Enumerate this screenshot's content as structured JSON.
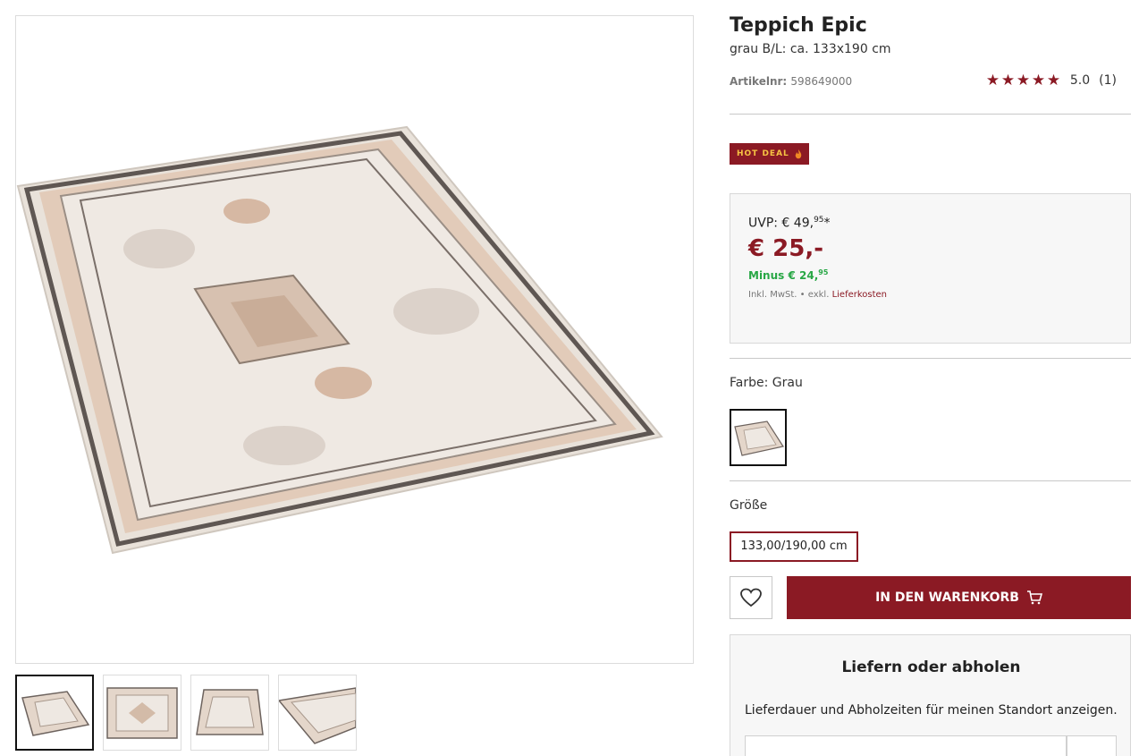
{
  "product": {
    "title": "Teppich Epic",
    "subtitle": "grau B/L: ca. 133x190 cm",
    "artnr_label": "Artikelnr:",
    "artnr_value": "598649000",
    "rating_value": "5.0",
    "rating_count": "(1)",
    "stars": 5
  },
  "badge": {
    "label": "HOT DEAL"
  },
  "pricing": {
    "uvp_prefix": "UVP: € 49,",
    "uvp_cents": "95",
    "uvp_suffix": "*",
    "price": "€ 25,-",
    "minus_prefix": "Minus € 24,",
    "minus_cents": "95",
    "tax_text": "Inkl. MwSt. • exkl.",
    "tax_link": "Lieferkosten"
  },
  "color": {
    "label": "Farbe: Grau"
  },
  "size": {
    "label": "Größe",
    "selected": "133,00/190,00 cm"
  },
  "actions": {
    "cart_label": "IN DEN WARENKORB"
  },
  "delivery": {
    "title": "Liefern oder abholen",
    "text": "Lieferdauer und Abholzeiten für meinen Standort anzeigen."
  },
  "colors": {
    "brand": "#8b1a24",
    "badge_text": "#f6c343",
    "discount": "#28a745"
  },
  "icons": [
    "star-icon",
    "flame-icon",
    "heart-icon",
    "cart-icon"
  ]
}
